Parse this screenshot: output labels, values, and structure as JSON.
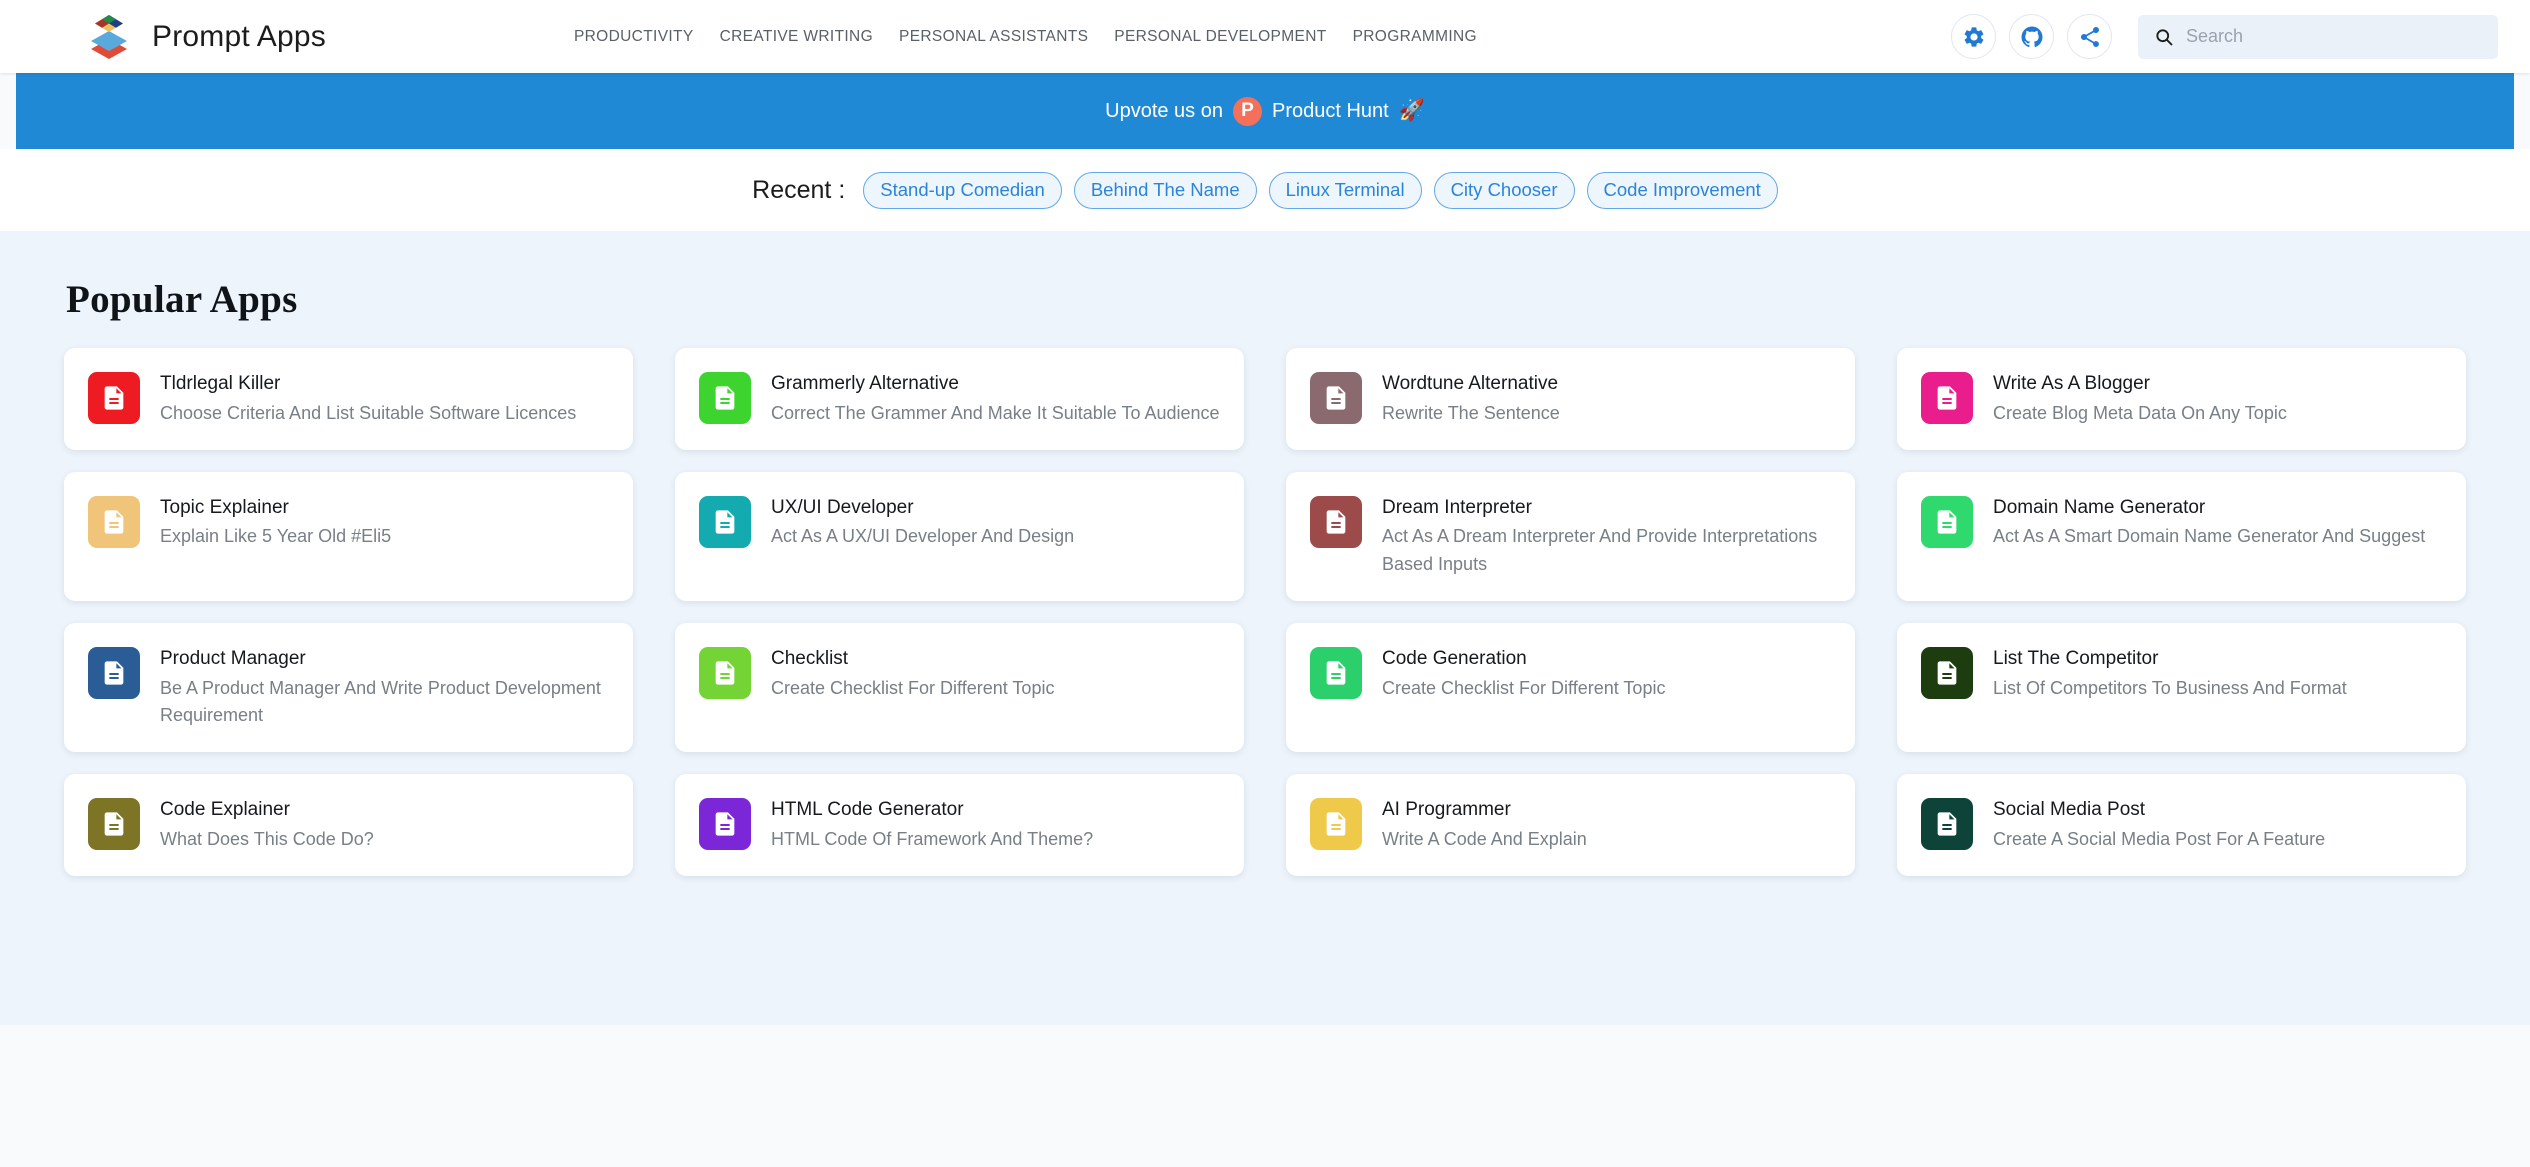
{
  "header": {
    "brand_name": "Prompt Apps",
    "logo_icon": "stacked-layers-logo",
    "nav": [
      {
        "label": "PRODUCTIVITY"
      },
      {
        "label": "CREATIVE WRITING"
      },
      {
        "label": "PERSONAL ASSISTANTS"
      },
      {
        "label": "PERSONAL DEVELOPMENT"
      },
      {
        "label": "PROGRAMMING"
      }
    ],
    "actions": [
      {
        "icon": "gear-icon"
      },
      {
        "icon": "github-icon"
      },
      {
        "icon": "share-icon"
      }
    ],
    "search": {
      "icon": "search-icon",
      "placeholder": "Search",
      "value": ""
    }
  },
  "banner": {
    "text_before": "Upvote us on",
    "badge_letter": "P",
    "text_after": "Product Hunt",
    "emoji": "🚀",
    "background": "#2089d6"
  },
  "recent": {
    "label": "Recent :",
    "items": [
      {
        "label": "Stand-up Comedian"
      },
      {
        "label": "Behind The Name"
      },
      {
        "label": "Linux Terminal"
      },
      {
        "label": "City Chooser"
      },
      {
        "label": "Code Improvement"
      }
    ]
  },
  "popular": {
    "title": "Popular Apps",
    "cards": [
      {
        "title": "Tldrlegal Killer",
        "desc": "Choose Criteria And List Suitable Software Licences",
        "color": "#ee1c22",
        "icon": "document-icon"
      },
      {
        "title": "Grammerly Alternative",
        "desc": "Correct The Grammer And Make It Suitable To Audience",
        "color": "#3dd430",
        "icon": "document-icon"
      },
      {
        "title": "Wordtune Alternative",
        "desc": "Rewrite The Sentence",
        "color": "#8a6a6e",
        "icon": "document-icon"
      },
      {
        "title": "Write As A Blogger",
        "desc": "Create Blog Meta Data On Any Topic",
        "color": "#e91e8c",
        "icon": "document-icon"
      },
      {
        "title": "Topic Explainer",
        "desc": "Explain Like 5 Year Old #Eli5",
        "color": "#f0c479",
        "icon": "document-icon"
      },
      {
        "title": "UX/UI Developer",
        "desc": "Act As A UX/UI Developer And Design",
        "color": "#14abb0",
        "icon": "document-icon"
      },
      {
        "title": "Dream Interpreter",
        "desc": "Act As A Dream Interpreter And Provide Interpretations Based Inputs",
        "color": "#9c4a4a",
        "icon": "document-icon"
      },
      {
        "title": "Domain Name Generator",
        "desc": "Act As A Smart Domain Name Generator And Suggest",
        "color": "#2fd96e",
        "icon": "document-icon"
      },
      {
        "title": "Product Manager",
        "desc": "Be A Product Manager And Write Product Development Requirement",
        "color": "#2a5d96",
        "icon": "document-icon"
      },
      {
        "title": "Checklist",
        "desc": "Create Checklist For Different Topic",
        "color": "#74d335",
        "icon": "document-icon"
      },
      {
        "title": "Code Generation",
        "desc": "Create Checklist For Different Topic",
        "color": "#2bcf6b",
        "icon": "document-icon"
      },
      {
        "title": "List The Competitor",
        "desc": "List Of Competitors To Business And Format",
        "color": "#1d3d10",
        "icon": "document-icon"
      },
      {
        "title": "Code Explainer",
        "desc": "What Does This Code Do?",
        "color": "#7d7425",
        "icon": "document-icon"
      },
      {
        "title": "HTML Code Generator",
        "desc": "HTML Code Of Framework And Theme?",
        "color": "#7b27d8",
        "icon": "document-icon"
      },
      {
        "title": "AI Programmer",
        "desc": "Write A Code And Explain",
        "color": "#eec94a",
        "icon": "document-icon"
      },
      {
        "title": "Social Media Post",
        "desc": "Create A Social Media Post For A Feature",
        "color": "#0e4339",
        "icon": "document-icon"
      }
    ]
  }
}
